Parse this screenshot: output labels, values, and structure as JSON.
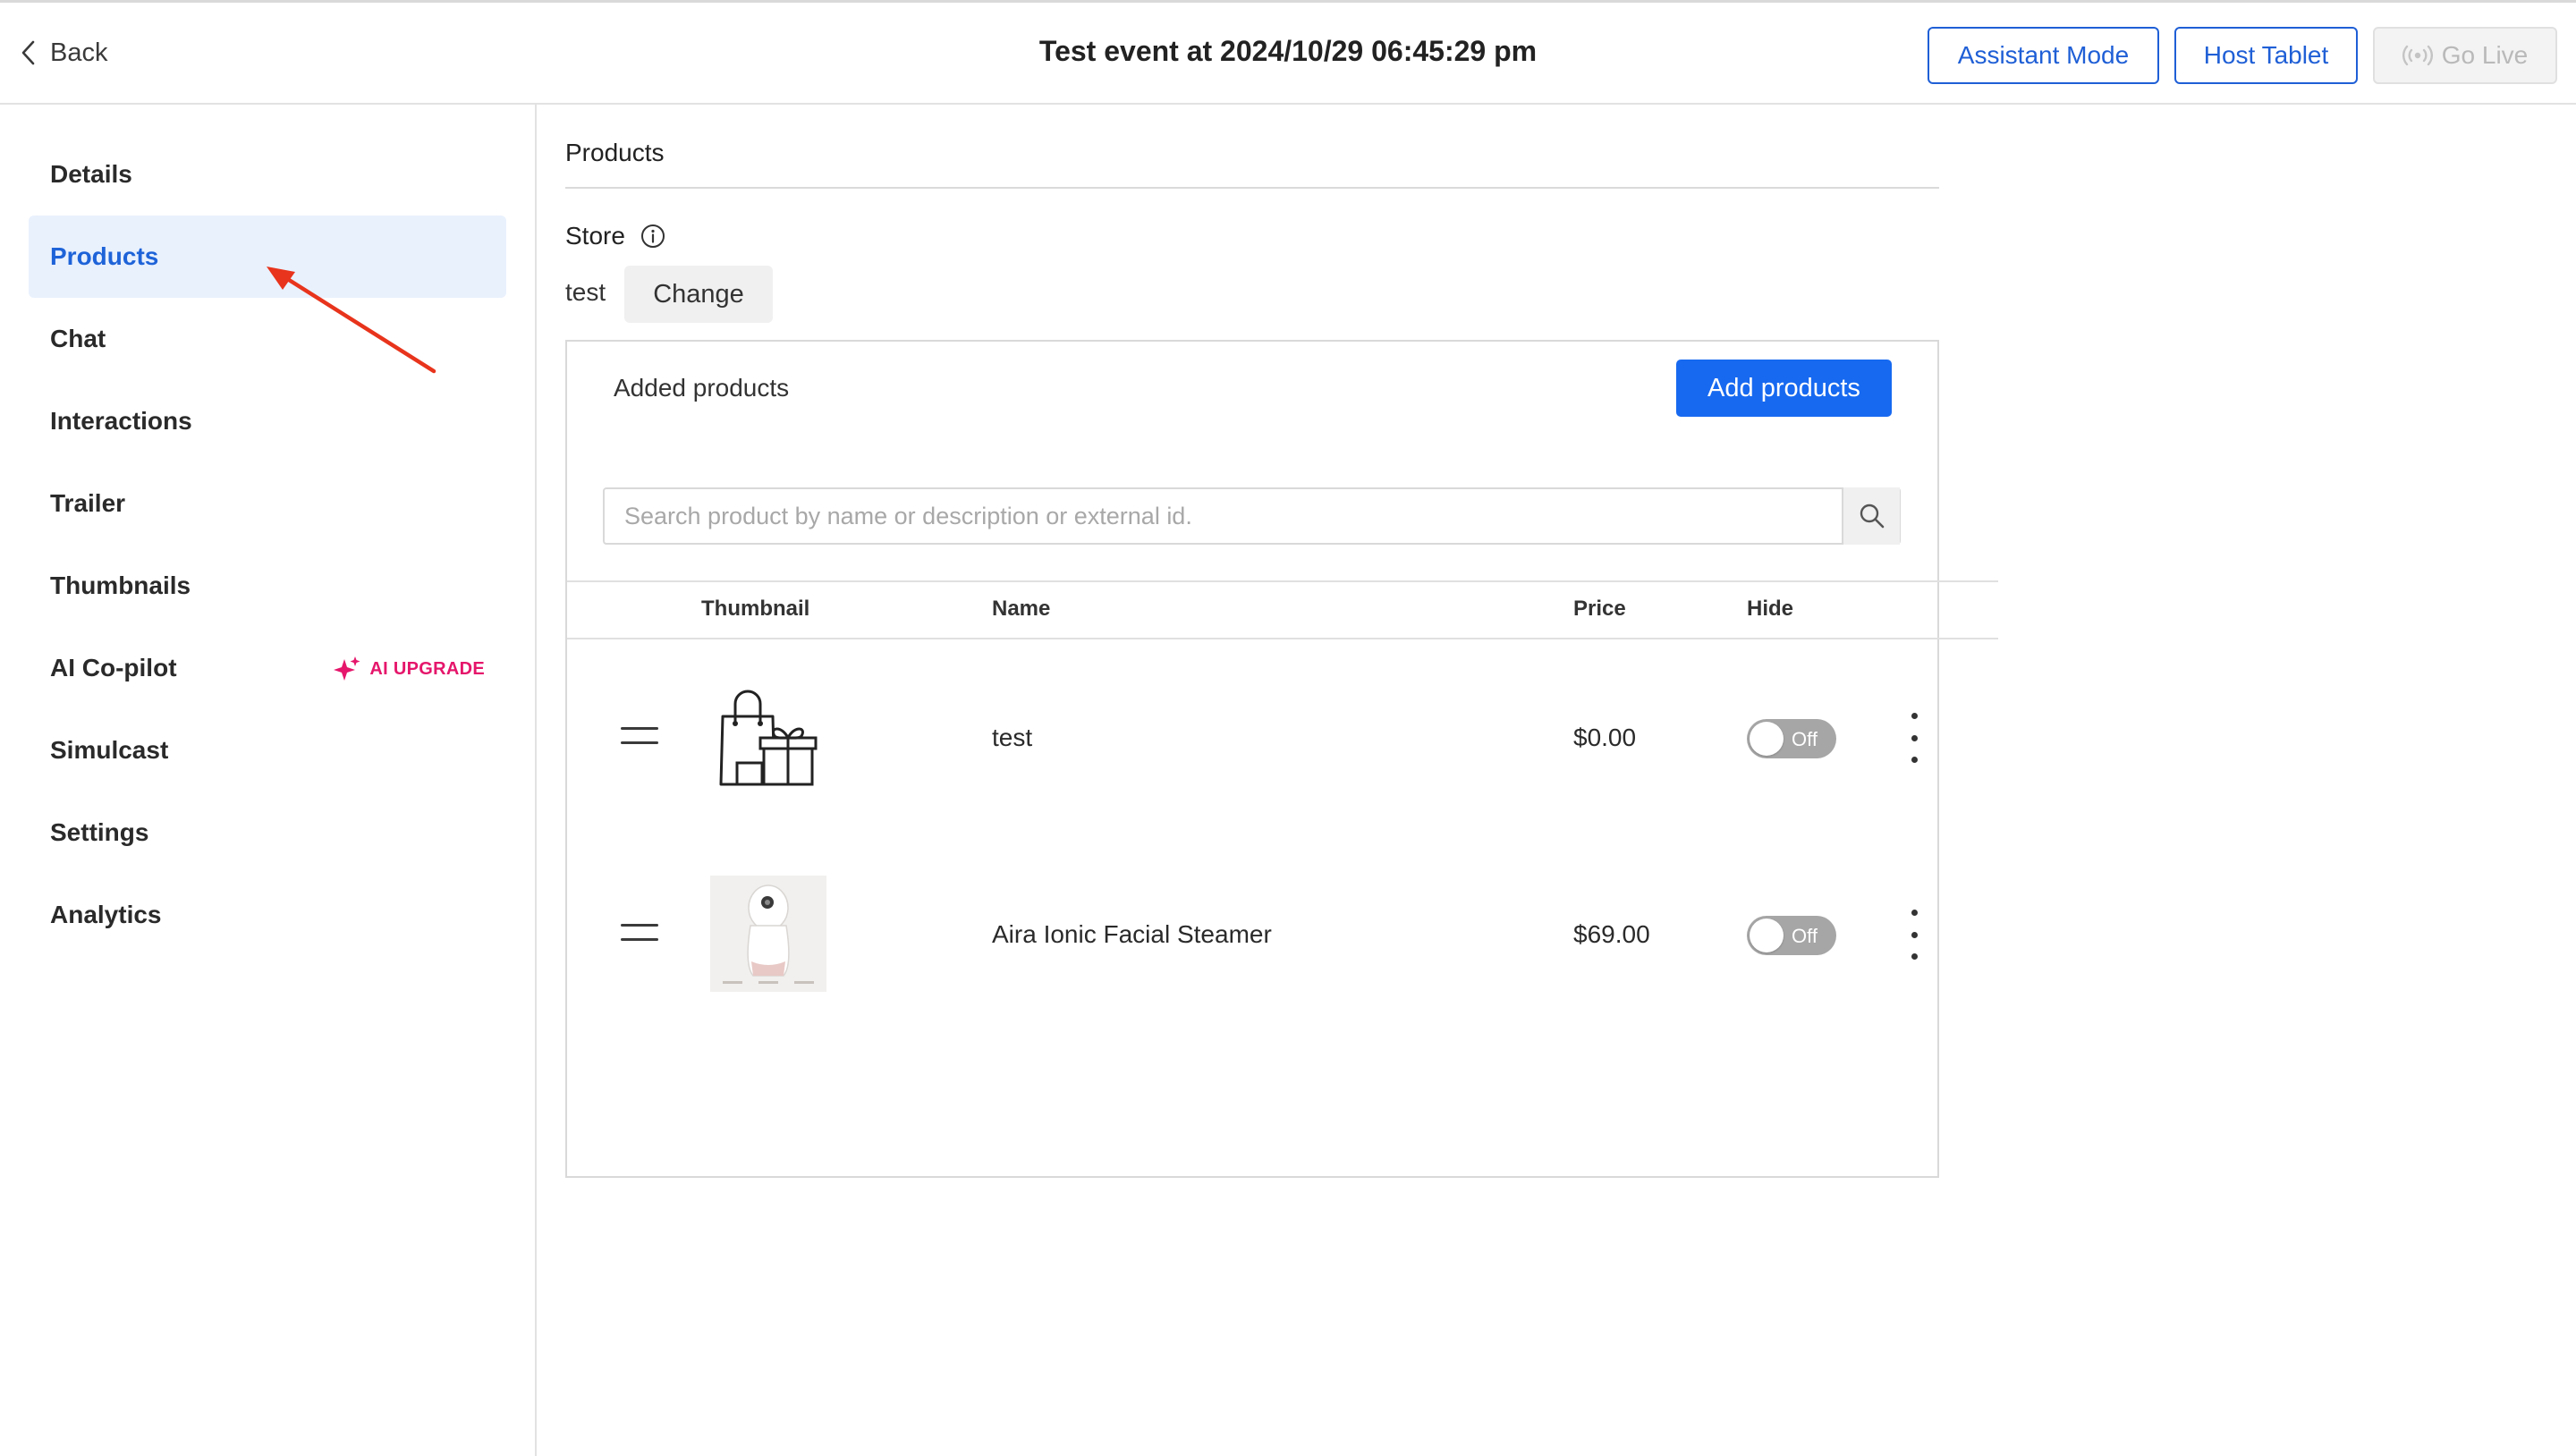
{
  "header": {
    "back_label": "Back",
    "title": "Test event at 2024/10/29 06:45:29 pm",
    "assistant_mode": "Assistant Mode",
    "host_tablet": "Host Tablet",
    "go_live": "Go Live"
  },
  "sidebar": {
    "items": [
      {
        "label": "Details"
      },
      {
        "label": "Products",
        "active": true
      },
      {
        "label": "Chat"
      },
      {
        "label": "Interactions"
      },
      {
        "label": "Trailer"
      },
      {
        "label": "Thumbnails"
      },
      {
        "label": "AI Co-pilot",
        "badge": "AI UPGRADE"
      },
      {
        "label": "Simulcast"
      },
      {
        "label": "Settings"
      },
      {
        "label": "Analytics"
      }
    ]
  },
  "products": {
    "section_title": "Products",
    "store_label": "Store",
    "store_name": "test",
    "change_label": "Change",
    "added_label": "Added products",
    "add_button": "Add products",
    "search_placeholder": "Search product by name or description or external id.",
    "columns": {
      "thumbnail": "Thumbnail",
      "name": "Name",
      "price": "Price",
      "hide": "Hide"
    },
    "rows": [
      {
        "name": "test",
        "price": "$0.00",
        "hide": "Off",
        "thumbnail_icon": "shopping-bag-gift-icon"
      },
      {
        "name": "Aira Ionic Facial Steamer",
        "price": "$69.00",
        "hide": "Off",
        "thumbnail_icon": "facial-steamer-image"
      }
    ]
  },
  "colors": {
    "accent": "#1769f0",
    "active_bg": "#e9f1fd",
    "ai_badge": "#e5166b",
    "annotation_arrow": "#e8341c"
  }
}
